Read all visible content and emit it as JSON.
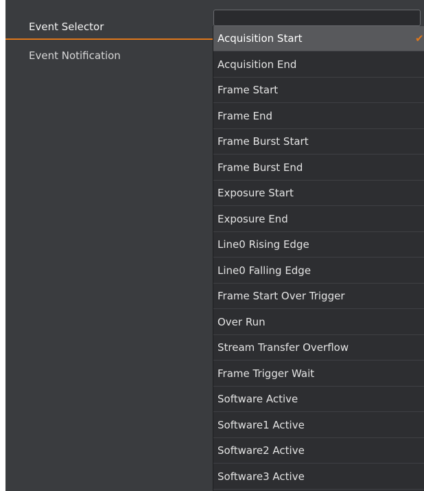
{
  "properties": {
    "event_selector_label": "Event Selector",
    "event_notification_label": "Event Notification"
  },
  "dropdown": {
    "selected_index": 0,
    "items": [
      "Acquisition Start",
      "Acquisition End",
      "Frame Start",
      "Frame End",
      "Frame Burst Start",
      "Frame Burst End",
      "Exposure Start",
      "Exposure End",
      "Line0 Rising Edge",
      "Line0 Falling Edge",
      "Frame Start Over Trigger",
      "Over Run",
      "Stream Transfer Overflow",
      "Frame Trigger Wait",
      "Software Active",
      "Software1 Active",
      "Software2 Active",
      "Software3 Active"
    ]
  },
  "icons": {
    "check": "check-icon"
  },
  "colors": {
    "accent": "#e0781c",
    "panel_bg": "#3a3c3f",
    "dropdown_bg": "#2d2e31",
    "selected_bg": "#58595c"
  }
}
